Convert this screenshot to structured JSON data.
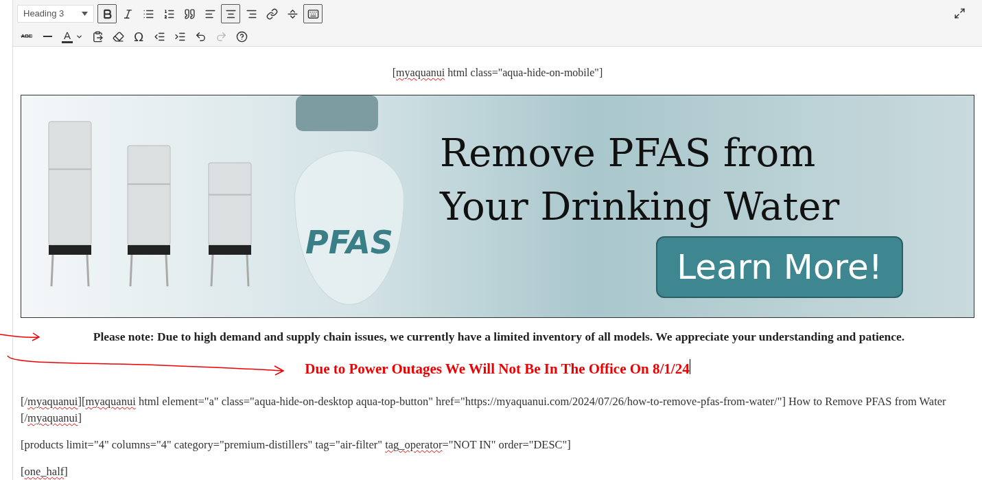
{
  "toolbar": {
    "format_select": {
      "value": "Heading 3"
    },
    "rows": [
      [
        {
          "kind": "bold",
          "active": true,
          "disabled": false
        },
        {
          "kind": "italic",
          "active": false,
          "disabled": false
        },
        {
          "kind": "bullet-list",
          "active": false,
          "disabled": false
        },
        {
          "kind": "numbered-list",
          "active": false,
          "disabled": false
        },
        {
          "kind": "blockquote",
          "active": false,
          "disabled": false
        },
        {
          "kind": "align-left",
          "active": false,
          "disabled": false
        },
        {
          "kind": "align-center",
          "active": true,
          "disabled": false
        },
        {
          "kind": "align-right",
          "active": false,
          "disabled": false
        },
        {
          "kind": "link",
          "active": false,
          "disabled": false
        },
        {
          "kind": "read-more",
          "active": false,
          "disabled": false
        },
        {
          "kind": "toolbar-toggle",
          "active": true,
          "disabled": false
        }
      ],
      [
        {
          "kind": "strikethrough",
          "active": false,
          "disabled": false,
          "label": "ABE"
        },
        {
          "kind": "horizontal-line",
          "active": false,
          "disabled": false
        },
        {
          "kind": "text-color",
          "active": false,
          "disabled": false,
          "label": "A"
        },
        {
          "kind": "paste-text",
          "active": false,
          "disabled": false
        },
        {
          "kind": "clear-formatting",
          "active": false,
          "disabled": false
        },
        {
          "kind": "special-character",
          "active": false,
          "disabled": false,
          "label": "Ω"
        },
        {
          "kind": "outdent",
          "active": false,
          "disabled": false
        },
        {
          "kind": "indent",
          "active": false,
          "disabled": false
        },
        {
          "kind": "undo",
          "active": false,
          "disabled": false
        },
        {
          "kind": "redo",
          "active": false,
          "disabled": true
        },
        {
          "kind": "help",
          "active": false,
          "disabled": false
        }
      ]
    ]
  },
  "content": {
    "shortcode_top": [
      {
        "text": "[",
        "misspelled": false
      },
      {
        "text": "myaquanui",
        "misspelled": true
      },
      {
        "text": " html class=\"aqua-hide-on-mobile\"]",
        "misspelled": false
      }
    ],
    "banner": {
      "headline": "Remove PFAS from Your Drinking Water",
      "drop_label": "PFAS",
      "cta": "Learn More!"
    },
    "notice": "Please note: Due to high demand and supply chain issues, we currently have a limited inventory of all models.  We appreciate your understanding and patience.",
    "alert": "Due to Power Outages We Will Not Be In The Office On 8/1/24",
    "paragraphs": [
      [
        {
          "text": "[/",
          "misspelled": false
        },
        {
          "text": "myaquanui",
          "misspelled": true
        },
        {
          "text": "][",
          "misspelled": false
        },
        {
          "text": "myaquanui",
          "misspelled": true
        },
        {
          "text": " html element=\"a\" class=\"aqua-hide-on-desktop aqua-top-button\" href=\"https://myaquanui.com/2024/07/26/how-to-remove-pfas-from-water/\"] How to Remove PFAS from Water [/",
          "misspelled": false
        },
        {
          "text": "myaquanui",
          "misspelled": true
        },
        {
          "text": "]",
          "misspelled": false
        }
      ],
      [
        {
          "text": "[products limit=\"4\" columns=\"4\" category=\"premium-distillers\" tag=\"air-filter\" ",
          "misspelled": false
        },
        {
          "text": "tag_operator",
          "misspelled": true
        },
        {
          "text": "=\"NOT IN\" order=\"DESC\"]",
          "misspelled": false
        }
      ],
      [
        {
          "text": "[",
          "misspelled": false
        },
        {
          "text": "one_half",
          "misspelled": true
        },
        {
          "text": "]",
          "misspelled": false
        }
      ]
    ]
  }
}
